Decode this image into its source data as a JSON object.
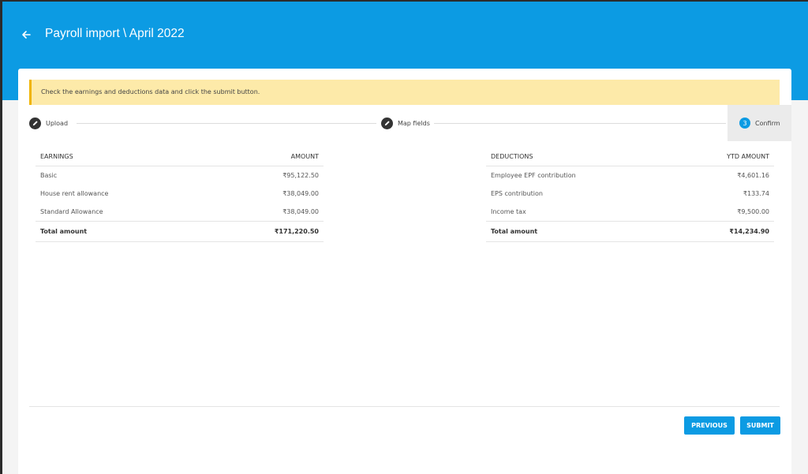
{
  "header": {
    "title": "Payroll import \\ April 2022",
    "back_icon": "arrow-left-icon"
  },
  "banner": {
    "text": "Check the earnings and deductions data and click the submit button."
  },
  "stepper": {
    "steps": [
      {
        "label": "Upload",
        "icon": "pencil-icon"
      },
      {
        "label": "Map fields",
        "icon": "pencil-icon"
      },
      {
        "label": "Confirm",
        "number": "3"
      }
    ]
  },
  "earnings": {
    "headers": [
      "EARNINGS",
      "AMOUNT"
    ],
    "rows": [
      [
        "Basic",
        "₹95,122.50"
      ],
      [
        "House rent allowance",
        "₹38,049.00"
      ],
      [
        "Standard Allowance",
        "₹38,049.00"
      ]
    ],
    "total": [
      "Total amount",
      "₹171,220.50"
    ]
  },
  "deductions": {
    "headers": [
      "DEDUCTIONS",
      "YTD AMOUNT"
    ],
    "rows": [
      [
        "Employee EPF contribution",
        "₹4,601.16"
      ],
      [
        "EPS contribution",
        "₹133.74"
      ],
      [
        "Income tax",
        "₹9,500.00"
      ]
    ],
    "total": [
      "Total amount",
      "₹14,234.90"
    ]
  },
  "buttons": {
    "previous": "PREVIOUS",
    "submit": "SUBMIT"
  },
  "colors": {
    "accent": "#0c9be3",
    "banner_bg": "#fdeaa9",
    "banner_border": "#f0b400"
  }
}
